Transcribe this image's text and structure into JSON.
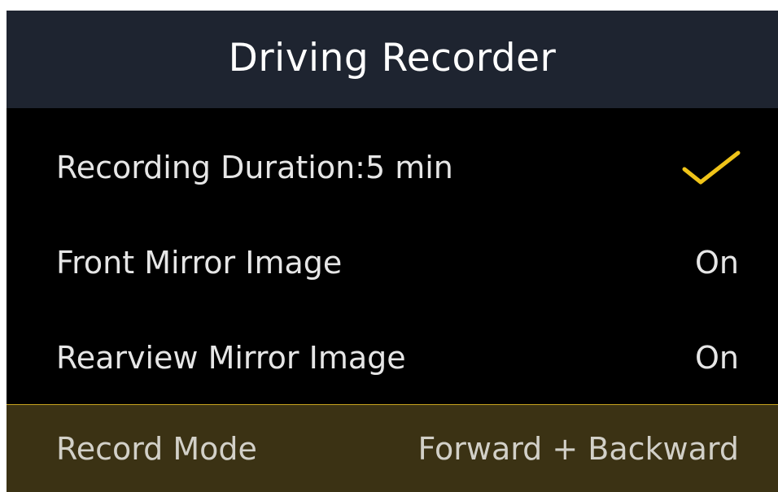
{
  "header": {
    "title": "Driving Recorder"
  },
  "rows": [
    {
      "label": "Recording Duration:5 min",
      "value": "",
      "icon": "check-icon"
    },
    {
      "label": "Front Mirror Image",
      "value": "On"
    },
    {
      "label": "Rearview Mirror Image",
      "value": "On"
    },
    {
      "label": "Record Mode",
      "value": "Forward + Backward",
      "selected": true
    }
  ],
  "colors": {
    "header_bg": "#1e2430",
    "background": "#000000",
    "selected_row_bg": "#3b3214",
    "accent": "#f0c419",
    "text": "#e6e6e6"
  }
}
